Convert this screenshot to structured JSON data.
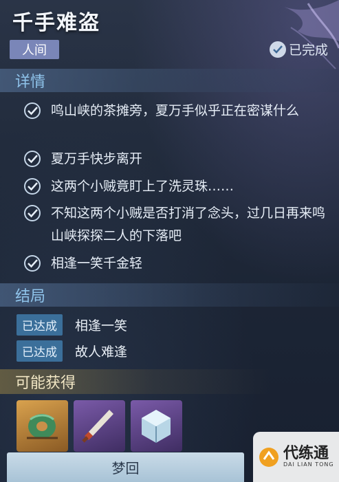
{
  "header": {
    "title": "千手难盗",
    "realm_tag": "人间",
    "status": "已完成"
  },
  "details": {
    "heading": "详情",
    "items": [
      {
        "text": "鸣山峡的茶摊旁，夏万手似乎正在密谋什么"
      },
      {
        "text": "夏万手快步离开"
      },
      {
        "text": "这两个小贼竟盯上了洗灵珠……"
      },
      {
        "text": "不知这两个小贼是否打消了念头，过几日再来鸣山峡探探二人的下落吧"
      },
      {
        "text": "相逢一笑千金轻"
      }
    ]
  },
  "endings": {
    "heading": "结局",
    "items": [
      {
        "badge": "已达成",
        "text": "相逢一笑"
      },
      {
        "badge": "已达成",
        "text": "故人难逢"
      }
    ]
  },
  "rewards": {
    "heading": "可能获得",
    "items": [
      {
        "icon": "jade-pendant-icon"
      },
      {
        "icon": "dagger-icon"
      },
      {
        "icon": "crystal-cube-icon"
      }
    ]
  },
  "actions": {
    "dream_return": "梦回"
  },
  "watermark": {
    "name": "代练通",
    "sub": "DAI LIAN TONG"
  },
  "colors": {
    "accent": "#8fc3ea",
    "badge": "#3b6f9a",
    "tag": "#7a86b8",
    "button": "#b9d0e0"
  }
}
